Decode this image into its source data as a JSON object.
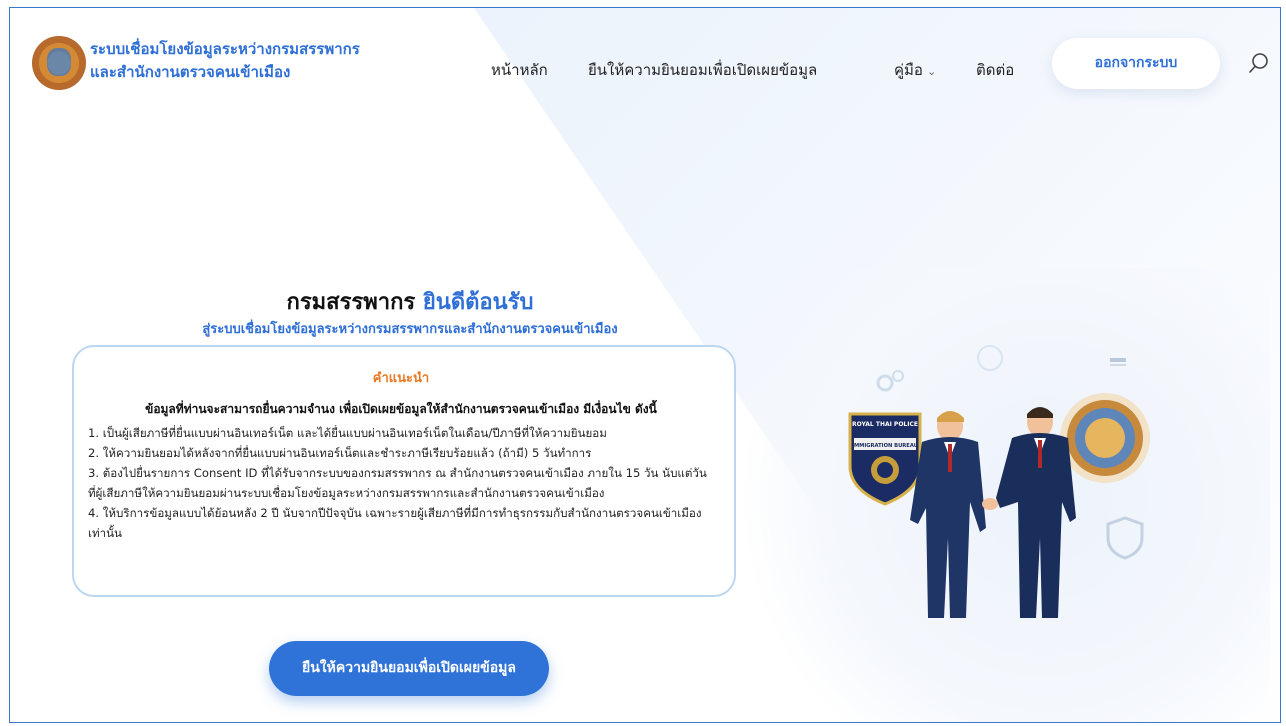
{
  "header": {
    "brand_line1": "ระบบเชื่อมโยงข้อมูลระหว่างกรมสรรพากร",
    "brand_line2": "และสำนักงานตรวจคนเข้าเมือง",
    "nav": {
      "home": "หน้าหลัก",
      "consent": "ยืนให้ความยินยอมเพื่อเปิดเผยข้อมูล",
      "manual": "คู่มือ",
      "contact": "ติดต่อ"
    },
    "logout_label": "ออกจากระบบ"
  },
  "hero": {
    "title_prefix": "กรมสรรพากร",
    "title_highlight": "ยินดีต้อนรับ",
    "subtitle": "สู่ระบบเชื่อมโยงข้อมูลระหว่างกรมสรรพากรและสำนักงานตรวจคนเข้าเมือง"
  },
  "card": {
    "heading": "คำแนะนำ",
    "lead": "ข้อมูลที่ท่านจะสามารถยื่นความจำนง เพื่อเปิดเผยข้อมูลให้สำนักงานตรวจคนเข้าเมือง มีเงื่อนไข ดังนี้",
    "items": [
      "1. เป็นผู้เสียภาษีที่ยื่นแบบผ่านอินเทอร์เน็ต และได้ยื่นแบบผ่านอินเทอร์เน็ตในเดือน/ปีภาษีที่ให้ความยินยอม",
      "2. ให้ความยินยอมได้หลังจากที่ยื่นแบบผ่านอินเทอร์เน็ตและชำระภาษีเรียบร้อยแล้ว (ถ้ามี) 5 วันทำการ",
      "3. ต้องไปยื่นรายการ Consent ID ที่ได้รับจากระบบของกรมสรรพากร ณ สำนักงานตรวจคนเข้าเมือง ภายใน 15 วัน นับแต่วันที่ผู้เสียภาษีให้ความยินยอมผ่านระบบเชื่อมโยงข้อมูลระหว่างกรมสรรพากรและสำนักงานตรวจคนเข้าเมือง",
      "4. ให้บริการข้อมูลแบบได้ย้อนหลัง 2 ปี นับจากปีปัจจุบัน เฉพาะรายผู้เสียภาษีที่มีการทำธุรกรรมกับสำนักงานตรวจคนเข้าเมืองเท่านั้น"
    ]
  },
  "consent_button": "ยืนให้ความยินยอมเพื่อเปิดเผยข้อมูล",
  "illustration": {
    "badge_text_top": "ROYAL THAI POLICE",
    "badge_text_band": "IMMIGRATION BUREAU"
  },
  "colors": {
    "accent": "#2f6fd6",
    "button": "#2f73d9",
    "heading_orange": "#e87a25",
    "card_border": "#bcd6f2"
  },
  "icons": [
    "search-icon",
    "chevron-down-icon",
    "logo-emblem",
    "police-badge",
    "revenue-seal",
    "shield-icon"
  ]
}
